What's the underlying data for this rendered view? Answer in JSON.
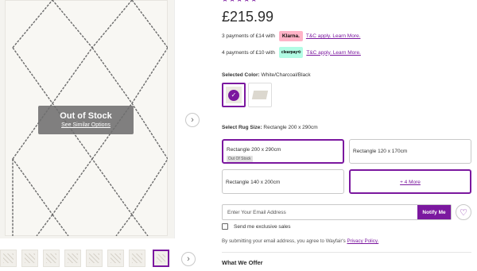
{
  "gallery": {
    "out_of_stock_title": "Out of Stock",
    "out_of_stock_link": "See Similar Options",
    "next_arrow": "›",
    "thumbnail_count": 8,
    "active_thumbnail": 8
  },
  "product": {
    "stars": "★★★★★",
    "review_count": "",
    "price": "£215.99",
    "accent_color": "#7b189f"
  },
  "payments": {
    "klarna_text": "3 payments of £14 with",
    "klarna_badge": "Klarna.",
    "klarna_link": "T&C apply. Learn More.",
    "clearpay_text": "4 payments of £10 with",
    "clearpay_badge": "clearpay⟲",
    "clearpay_link": "T&C apply. Learn More."
  },
  "color": {
    "label": "Selected Color:",
    "value": "White/Charcoal/Black",
    "check_icon": "✓"
  },
  "size": {
    "label": "Select Rug Size:",
    "value": "Rectangle 200 x 290cm",
    "options": [
      {
        "label": "Rectangle 200 x 290cm",
        "tag": "Out Of Stock",
        "selected": true
      },
      {
        "label": "Rectangle 120 x 170cm"
      },
      {
        "label": "Rectangle 140 x 200cm"
      }
    ],
    "more_label": "+ 4 More"
  },
  "notify": {
    "email_placeholder": "Enter Your Email Address",
    "button_label": "Notify Me",
    "heart_icon": "♡",
    "checkbox_label": "Send me exclusive sales",
    "disclaimer_text": "By submitting your email address, you agree to Wayfair's",
    "privacy_link": "Privacy Policy.",
    "checkbox_checked": false
  },
  "section": {
    "what_we_offer": "What We Offer"
  }
}
